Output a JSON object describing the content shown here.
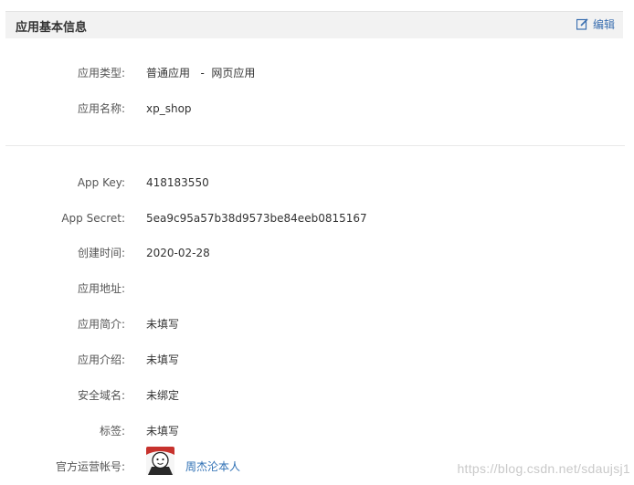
{
  "panel": {
    "title": "应用基本信息",
    "edit_label": "编辑"
  },
  "basic": [
    {
      "label": "应用类型:",
      "value": "普通应用   -  网页应用"
    },
    {
      "label": "应用名称:",
      "value": "xp_shop"
    }
  ],
  "details": [
    {
      "label": "App Key:",
      "value": "418183550"
    },
    {
      "label": "App Secret:",
      "value": "5ea9c95a57b38d9573be84eeb0815167"
    },
    {
      "label": "创建时间:",
      "value": "2020-02-28"
    },
    {
      "label": "应用地址:",
      "value": ""
    },
    {
      "label": "应用简介:",
      "value": "未填写"
    },
    {
      "label": "应用介绍:",
      "value": "未填写"
    },
    {
      "label": "安全域名:",
      "value": "未绑定"
    },
    {
      "label": "标签:",
      "value": "未填写"
    }
  ],
  "official_account": {
    "label": "官方运营帐号:",
    "name": "周杰沦本人"
  },
  "watermark": "https://blog.csdn.net/sdaujsj1",
  "colors": {
    "header_bg": "#f2f2f2",
    "link": "#2d6fb4"
  }
}
